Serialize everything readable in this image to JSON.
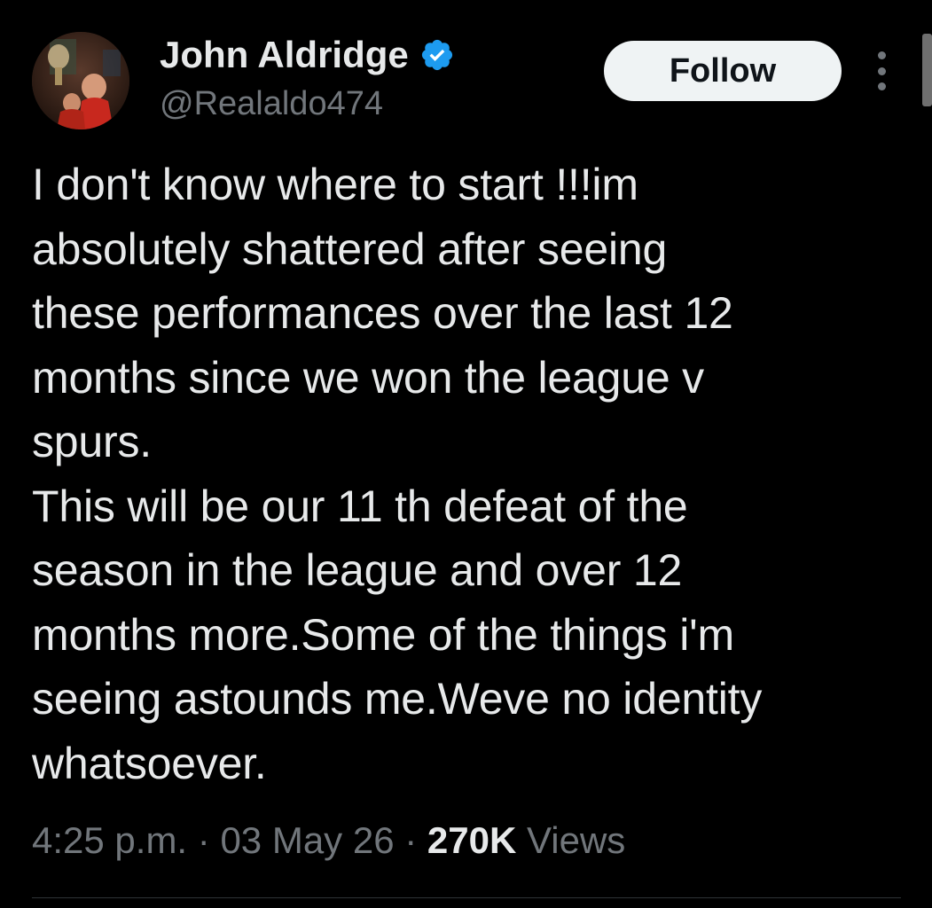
{
  "author": {
    "display_name": "John Aldridge",
    "handle": "@Realaldo474",
    "verified": true,
    "verified_color": "#1d9bf0"
  },
  "actions": {
    "follow_label": "Follow",
    "more_icon": "more-vertical-icon"
  },
  "tweet": {
    "text": "I don't know where to start !!!im\nabsolutely shattered after seeing\nthese performances over the last 12\nmonths since we won the league v\nspurs.\nThis will be our 11 th defeat of the\nseason in the league and over 12\nmonths more.Some of the things i'm\nseeing astounds me.Weve no identity\nwhatsoever."
  },
  "meta": {
    "time": "4:25 p.m.",
    "separator": "·",
    "date": "03 May 26",
    "views_count": "270K",
    "views_label": "Views"
  },
  "colors": {
    "background": "#000000",
    "primary_text": "#e7e9ea",
    "secondary_text": "#71767b",
    "follow_bg": "#eff3f4"
  }
}
